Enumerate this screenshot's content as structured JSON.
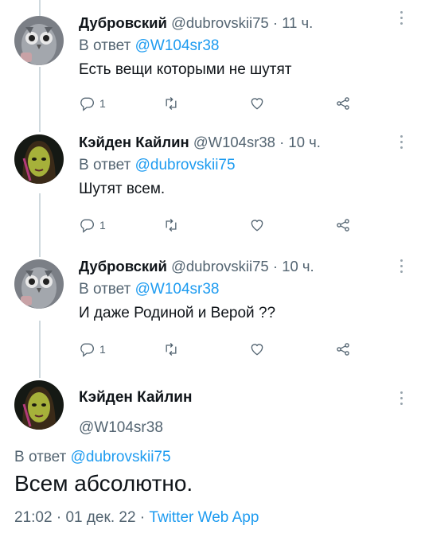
{
  "thread": [
    {
      "author_name": "Дубровский",
      "handle": "@dubrovskii75",
      "time": "11 ч.",
      "reply_prefix": "В ответ",
      "reply_to": "@W104sr38",
      "text": "Есть вещи которыми не шутят",
      "reply_count": "1",
      "avatar": "owl-avatar"
    },
    {
      "author_name": "Кэйден Кайлин",
      "handle": "@W104sr38",
      "time": "10 ч.",
      "reply_prefix": "В ответ",
      "reply_to": "@dubrovskii75",
      "text": "Шутят всем.",
      "reply_count": "1",
      "avatar": "green-face-avatar"
    },
    {
      "author_name": "Дубровский",
      "handle": "@dubrovskii75",
      "time": "10 ч.",
      "reply_prefix": "В ответ",
      "reply_to": "@W104sr38",
      "text": "И даже Родиной и Верой ??",
      "reply_count": "1",
      "avatar": "owl-avatar"
    }
  ],
  "main_tweet": {
    "author_name": "Кэйден Кайлин",
    "handle": "@W104sr38",
    "reply_prefix": "В ответ",
    "reply_to": "@dubrovskii75",
    "text": "Всем абсолютно.",
    "time": "21:02",
    "date": "01 дек. 22",
    "source": "Twitter Web App",
    "separator": "·",
    "avatar": "green-face-avatar"
  },
  "colors": {
    "accent": "#1d9bf0",
    "muted": "#536471",
    "text": "#0f1419",
    "line": "#cfd9de"
  },
  "icons": [
    "reply-icon",
    "retweet-icon",
    "like-icon",
    "share-icon",
    "more-icon"
  ]
}
